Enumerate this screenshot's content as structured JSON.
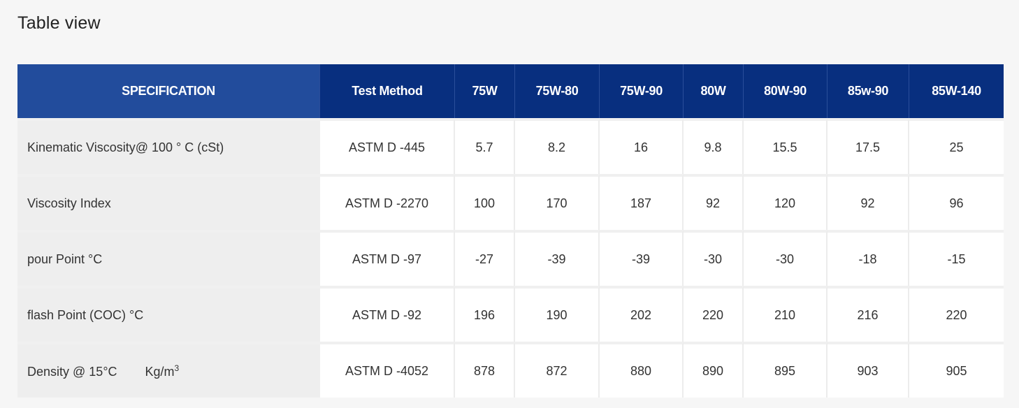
{
  "page": {
    "title": "Table view"
  },
  "table": {
    "headers": [
      "SPECIFICATION",
      "Test Method",
      "75W",
      "75W-80",
      "75W-90",
      "80W",
      "80W-90",
      "85w-90",
      "85W-140"
    ],
    "rows": [
      {
        "spec": "Kinematic Viscosity@  100 ° C  (cSt)",
        "method": "ASTM D -445",
        "values": [
          "5.7",
          "8.2",
          "16",
          "9.8",
          "15.5",
          "17.5",
          "25"
        ]
      },
      {
        "spec": "Viscosity Index",
        "method": "ASTM D -2270",
        "values": [
          "100",
          "170",
          "187",
          "92",
          "120",
          "92",
          "96"
        ]
      },
      {
        "spec": "pour Point °C",
        "method": "ASTM D -97",
        "values": [
          "-27",
          "-39",
          "-39",
          "-30",
          "-30",
          "-18",
          "-15"
        ]
      },
      {
        "spec": "flash Point (COC) °C",
        "method": "ASTM D -92",
        "values": [
          "196",
          "190",
          "202",
          "220",
          "210",
          "216",
          "220"
        ]
      },
      {
        "spec": "Density  @ 15°C",
        "spec_unit": "Kg/m",
        "spec_unit_exp": "3",
        "method": "ASTM D -4052",
        "values": [
          "878",
          "872",
          "880",
          "890",
          "895",
          "903",
          "905"
        ]
      }
    ]
  },
  "colors": {
    "header_blue": "#082f7f",
    "spec_header_blue": "#224c9c",
    "page_background": "#f6f6f6"
  }
}
